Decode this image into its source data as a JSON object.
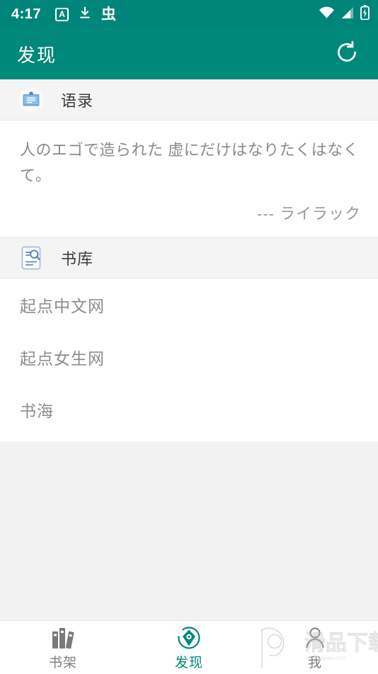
{
  "status_bar": {
    "time": "4:17",
    "left_icons": [
      {
        "name": "app-badge-a-icon",
        "glyph": "A"
      },
      {
        "name": "download-icon",
        "glyph": "download"
      },
      {
        "name": "app-badge-chong-icon",
        "glyph": "虫"
      }
    ],
    "right_icons": [
      {
        "name": "wifi-icon"
      },
      {
        "name": "cellular-signal-icon"
      },
      {
        "name": "battery-charging-icon"
      }
    ]
  },
  "app_bar": {
    "title": "发现",
    "refresh_label": "刷新"
  },
  "sections": {
    "quotes": {
      "icon": "clipboard-note-icon",
      "title": "语录",
      "text": "人のエゴで造られた 虚にだけはなりたくはなくて。",
      "author": "--- ライラック"
    },
    "library": {
      "icon": "document-search-icon",
      "title": "书库",
      "items": [
        {
          "label": "起点中文网"
        },
        {
          "label": "起点女生网"
        },
        {
          "label": "书海"
        }
      ]
    }
  },
  "bottom_nav": {
    "items": [
      {
        "label": "书架",
        "icon": "books-icon",
        "active": false
      },
      {
        "label": "发现",
        "icon": "compass-icon",
        "active": true
      },
      {
        "label": "我",
        "icon": "person-icon",
        "active": false
      }
    ]
  },
  "watermark": {
    "text": "滑品下载",
    "site": "www.pipaw.com"
  },
  "colors": {
    "status_bar": "#00857a",
    "app_bar": "#00897b",
    "accent": "#00897b",
    "section_bg": "#f4f4f4",
    "page_bg": "#f2f2f2",
    "text_muted": "#8a8a8a"
  }
}
